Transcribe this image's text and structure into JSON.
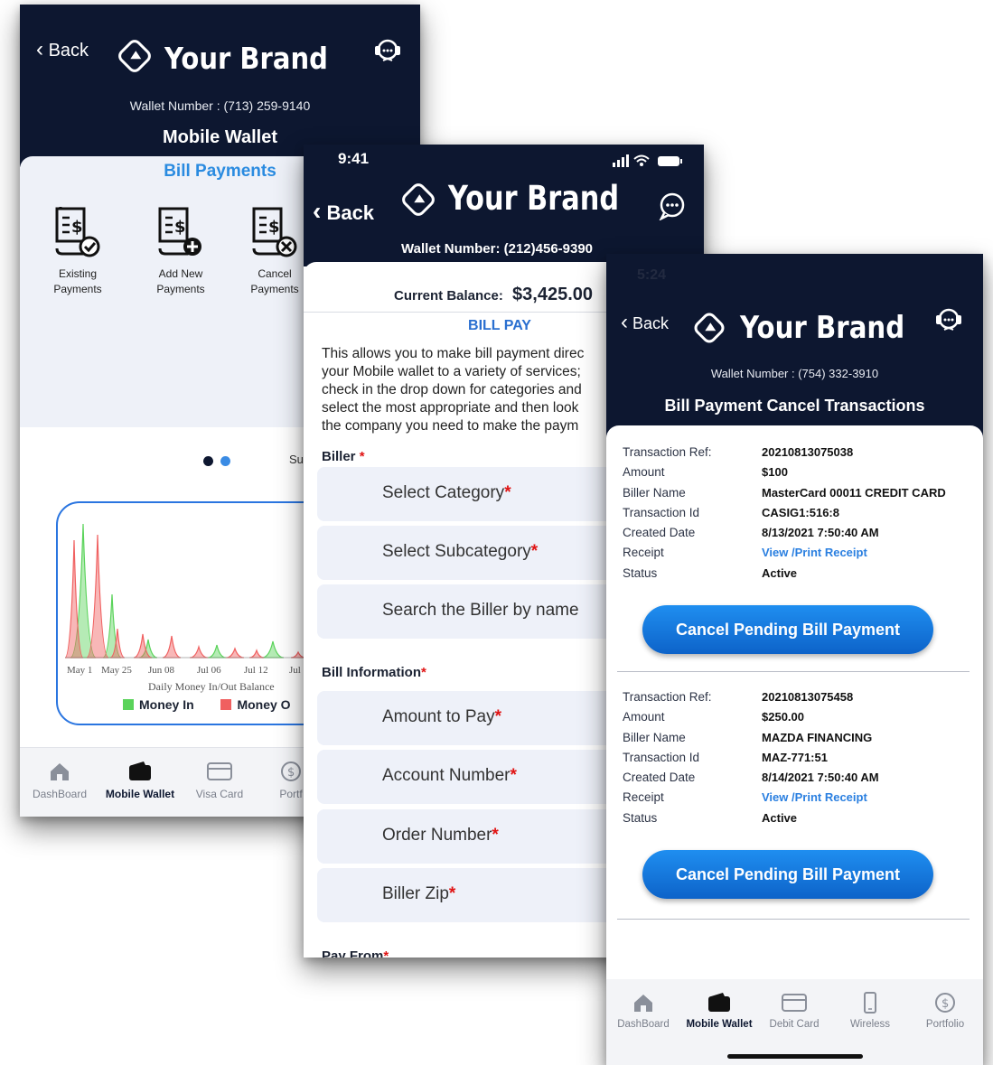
{
  "screens": {
    "wallet": {
      "back": "Back",
      "brand": "Your Brand",
      "wallet_number": "Wallet Number : (713) 259-9140",
      "title": "Mobile Wallet",
      "section": "Bill Payments",
      "actions": [
        {
          "label": "Existing Payments",
          "icon": "bill-check-icon"
        },
        {
          "label": "Add New Payments",
          "icon": "bill-add-icon"
        },
        {
          "label": "Cancel Payments",
          "icon": "bill-cancel-icon"
        }
      ],
      "pager_next_label": "Su",
      "chart": {
        "x_ticks": [
          "May 1",
          "May 25",
          "Jun 08",
          "Jul 06",
          "Jul 12",
          "Jul"
        ],
        "x_title": "Daily Money In/Out Balance",
        "legend_in": "Money In",
        "legend_out": "Money O",
        "color_in": "#5ad35a",
        "color_out": "#f06060"
      },
      "tabs": [
        {
          "label": "DashBoard",
          "icon": "home-icon"
        },
        {
          "label": "Mobile Wallet",
          "icon": "wallet-icon"
        },
        {
          "label": "Visa Card",
          "icon": "card-icon"
        },
        {
          "label": "Portf",
          "icon": "portfolio-icon"
        }
      ]
    },
    "billpay": {
      "time": "9:41",
      "back": "Back",
      "brand": "Your Brand",
      "wallet_number": "Wallet Number: (212)456-9390",
      "balance_label": "Current Balance:",
      "balance_value": "$3,425.00",
      "heading": "BILL PAY",
      "description": [
        "This allows you to make bill payment direc",
        "your Mobile wallet to a variety of services;",
        "check in the drop down for categories and",
        "select the most appropriate and then look",
        "the company you need to make the paym"
      ],
      "biller_label": "Biller",
      "biller_fields": [
        "Select Category",
        "Select Subcategory",
        "Search the Biller by name"
      ],
      "info_label": "Bill Information",
      "info_fields": [
        "Amount to Pay",
        "Account Number",
        "Order Number",
        "Biller Zip"
      ],
      "pay_from_label": "Pay From"
    },
    "cancel": {
      "time": "5:24",
      "back": "Back",
      "brand": "Your Brand",
      "wallet_number": "Wallet Number : (754) 332-3910",
      "title": "Bill Payment Cancel Transactions",
      "field_labels": {
        "ref": "Transaction Ref:",
        "amount": "Amount",
        "biller": "Biller Name",
        "txid": "Transaction Id",
        "created": "Created Date",
        "receipt": "Receipt",
        "status": "Status"
      },
      "transactions": [
        {
          "ref": "20210813075038",
          "amount": "$100",
          "biller": "MasterCard 00011 CREDIT CARD",
          "txid": "CASIG1:516:8",
          "created": "8/13/2021 7:50:40 AM",
          "receipt": "View /Print Receipt",
          "status": "Active"
        },
        {
          "ref": "20210813075458",
          "amount": "$250.00",
          "biller": "MAZDA FINANCING",
          "txid": "MAZ-771:51",
          "created": "8/14/2021 7:50:40 AM",
          "receipt": "View /Print Receipt",
          "status": "Active"
        }
      ],
      "cancel_button": "Cancel Pending Bill Payment",
      "tabs": [
        {
          "label": "DashBoard",
          "icon": "home-icon"
        },
        {
          "label": "Mobile Wallet",
          "icon": "wallet-icon"
        },
        {
          "label": "Debit Card",
          "icon": "card-icon"
        },
        {
          "label": "Wireless",
          "icon": "phone-icon"
        },
        {
          "label": "Portfolio",
          "icon": "portfolio-icon"
        }
      ]
    }
  },
  "theme": {
    "navy": "#0d1730",
    "accent_blue": "#2a8be0",
    "button_blue": "#1478dc",
    "required_red": "#e01414"
  }
}
